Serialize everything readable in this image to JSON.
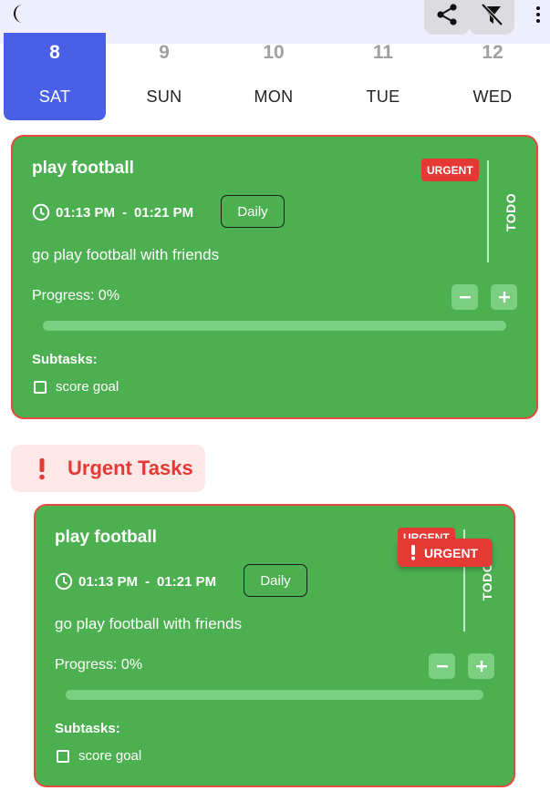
{
  "topbar": {
    "theme_icon": "moon-icon",
    "share_icon": "share-icon",
    "filter_icon": "filter-off-icon",
    "menu_icon": "more-vert-icon"
  },
  "date_strip": {
    "days": [
      {
        "num": "8",
        "weekday": "SAT",
        "selected": true
      },
      {
        "num": "9",
        "weekday": "SUN",
        "selected": false
      },
      {
        "num": "10",
        "weekday": "MON",
        "selected": false
      },
      {
        "num": "11",
        "weekday": "TUE",
        "selected": false
      },
      {
        "num": "12",
        "weekday": "WED",
        "selected": false
      }
    ]
  },
  "tasks": [
    {
      "title": "play football",
      "start_time": "01:13 PM",
      "separator": "-",
      "end_time": "01:21 PM",
      "frequency": "Daily",
      "description": "go play football with friends",
      "progress_label": "Progress: 0%",
      "progress": 0,
      "subtasks_title": "Subtasks:",
      "subtasks": [
        {
          "label": "score goal",
          "done": false
        }
      ],
      "priority": "URGENT",
      "status": "TODO"
    }
  ],
  "urgent_section": {
    "label": "Urgent Tasks",
    "icon": "exclamation-icon",
    "tag_label": "URGENT",
    "task": {
      "title": "play football",
      "start_time": "01:13 PM",
      "separator": "-",
      "end_time": "01:21 PM",
      "frequency": "Daily",
      "description": "go play football with friends",
      "progress_label": "Progress: 0%",
      "progress": 0,
      "subtasks_title": "Subtasks:",
      "subtasks": [
        {
          "label": "score goal",
          "done": false
        }
      ],
      "priority": "URGENT",
      "status": "TODO"
    }
  },
  "colors": {
    "accent": "#4a5fe7",
    "card_green": "#4caf50",
    "urgent_red": "#e53935",
    "topbar_bg": "#eeeefc"
  }
}
